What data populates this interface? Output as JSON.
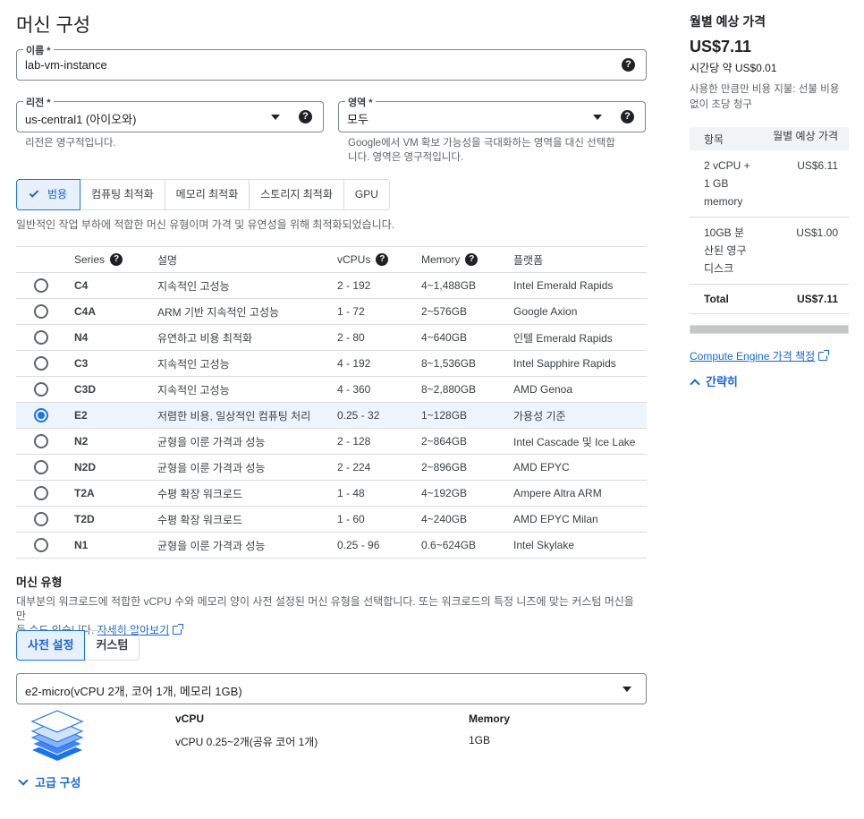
{
  "page_title": "머신 구성",
  "name_field": {
    "label": "이름 *",
    "value": "lab-vm-instance"
  },
  "region_field": {
    "label": "리전 *",
    "value": "us-central1 (아이오와)",
    "hint": "리전은 영구적입니다."
  },
  "zone_field": {
    "label": "영역 *",
    "value": "모두",
    "hint_line1": "Google에서 VM 확보 가능성을 극대화하는 영역을 대신 선택합",
    "hint_line2": "니다. 영역은 영구적입니다."
  },
  "help_glyph": "?",
  "tabs": [
    {
      "label": "범용",
      "active": true
    },
    {
      "label": "컴퓨팅 최적화"
    },
    {
      "label": "메모리 최적화"
    },
    {
      "label": "스토리지 최적화"
    },
    {
      "label": "GPU"
    }
  ],
  "tab_description": "일반적인 작업 부하에 적합한 머신 유형이며 가격 및 유연성을 위해 최적화되었습니다.",
  "series_table": {
    "headers": {
      "series": "Series",
      "desc": "설명",
      "vcpus": "vCPUs",
      "memory": "Memory",
      "platform": "플랫폼"
    },
    "rows": [
      {
        "name": "C4",
        "desc": "지속적인 고성능",
        "vcpus": "2 - 192",
        "memory": "4~1,488GB",
        "platform": "Intel Emerald Rapids"
      },
      {
        "name": "C4A",
        "desc": "ARM 기반 지속적인 고성능",
        "vcpus": "1 - 72",
        "memory": "2~576GB",
        "platform": "Google Axion"
      },
      {
        "name": "N4",
        "desc": "유연하고 비용 최적화",
        "vcpus": "2 - 80",
        "memory": "4~640GB",
        "platform": "인텔 Emerald Rapids"
      },
      {
        "name": "C3",
        "desc": "지속적인 고성능",
        "vcpus": "4 - 192",
        "memory": "8~1,536GB",
        "platform": "Intel Sapphire Rapids"
      },
      {
        "name": "C3D",
        "desc": "지속적인 고성능",
        "vcpus": "4 - 360",
        "memory": "8~2,880GB",
        "platform": "AMD Genoa"
      },
      {
        "name": "E2",
        "desc": "저렴한 비용, 일상적인 컴퓨팅 처리",
        "vcpus": "0.25 - 32",
        "memory": "1~128GB",
        "platform": "가용성 기준"
      },
      {
        "name": "N2",
        "desc": "균형을 이룬 가격과 성능",
        "vcpus": "2 - 128",
        "memory": "2~864GB",
        "platform": "Intel Cascade 및 Ice Lake"
      },
      {
        "name": "N2D",
        "desc": "균형을 이룬 가격과 성능",
        "vcpus": "2 - 224",
        "memory": "2~896GB",
        "platform": "AMD EPYC"
      },
      {
        "name": "T2A",
        "desc": "수평 확장 워크로드",
        "vcpus": "1 - 48",
        "memory": "4~192GB",
        "platform": "Ampere Altra ARM"
      },
      {
        "name": "T2D",
        "desc": "수평 확장 워크로드",
        "vcpus": "1 - 60",
        "memory": "4~240GB",
        "platform": "AMD EPYC Milan"
      },
      {
        "name": "N1",
        "desc": "균형을 이룬 가격과 성능",
        "vcpus": "0.25 - 96",
        "memory": "0.6~624GB",
        "platform": "Intel Skylake"
      }
    ],
    "selected": "E2"
  },
  "machine_type": {
    "title": "머신 유형",
    "desc_line1": "대부분의 워크로드에 적합한 vCPU 수와 메모리 양이 사전 설정된 머신 유형을 선택합니다. 또는 워크로드의 특정 니즈에 맞는 커스텀 머신을 만",
    "desc_line2": "들 수도 있습니다.",
    "learn_more": "자세히 알아보기",
    "seg_preset": "사전 설정",
    "seg_custom": "커스텀",
    "select_value": "e2-micro(vCPU 2개, 코어 1개, 메모리 1GB)",
    "vcpu_label": "vCPU",
    "vcpu_value": "vCPU 0.25~2개(공유 코어 1개)",
    "memory_label": "Memory",
    "memory_value": "1GB",
    "advanced": "고급 구성"
  },
  "sidebar": {
    "heading": "월별 예상 가격",
    "price": "US$7.11",
    "hourly": "시간당 약 US$0.01",
    "note": "사용한 만큼만 비용 지불: 선불 비용 없이 초당 청구",
    "table": {
      "col_item": "항목",
      "col_price": "월별 예상 가격",
      "row1_item": "2 vCPU + 1 GB memory",
      "row1_price": "US$6.11",
      "row2_item": "10GB 분산된 영구 디스크",
      "row2_price": "US$1.00",
      "total_label": "Total",
      "total_price": "US$7.11"
    },
    "pricing_link": "Compute Engine 가격 책정",
    "collapse": "간략히"
  },
  "colors": {
    "accent": "#1a73e8",
    "selected_row_bg": "#f1f6fe"
  }
}
